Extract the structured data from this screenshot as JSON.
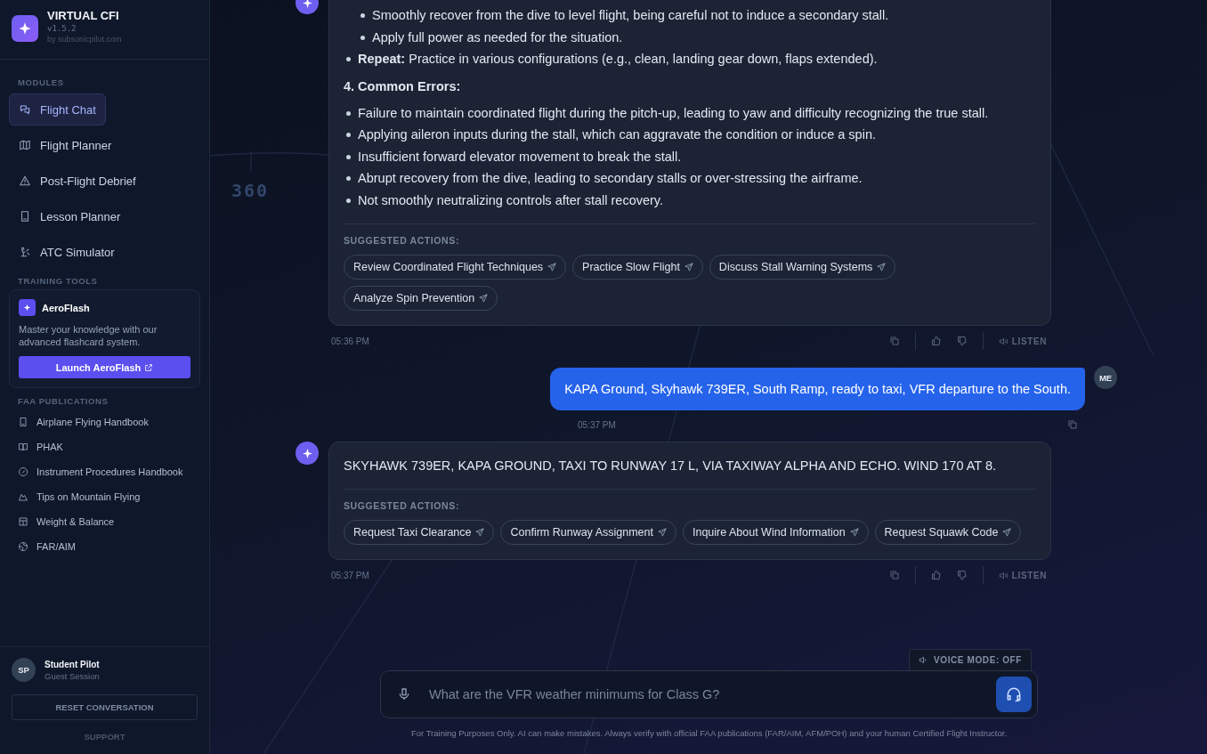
{
  "app": {
    "name": "VIRTUAL CFI",
    "version": "v1.5.2",
    "byline": "by subsonicpilot.com"
  },
  "sidebar": {
    "modules_label": "MODULES",
    "modules": [
      {
        "label": "Flight Chat",
        "selected": true
      },
      {
        "label": "Flight Planner",
        "selected": false
      },
      {
        "label": "Post-Flight Debrief",
        "selected": false
      },
      {
        "label": "Lesson Planner",
        "selected": false
      },
      {
        "label": "ATC Simulator",
        "selected": false
      }
    ],
    "training_label": "TRAINING TOOLS",
    "aeroflash": {
      "title": "AeroFlash",
      "description": "Master your knowledge with our advanced flashcard system.",
      "button": "Launch AeroFlash"
    },
    "publications_label": "FAA PUBLICATIONS",
    "publications": [
      "Airplane Flying Handbook",
      "PHAK",
      "Instrument Procedures Handbook",
      "Tips on Mountain Flying",
      "Weight & Balance",
      "FAR/AIM"
    ],
    "user": {
      "initials": "SP",
      "name": "Student Pilot",
      "session": "Guest Session"
    },
    "reset_button": "RESET CONVERSATION",
    "support_link": "SUPPORT"
  },
  "background_heading": "360",
  "chat": {
    "messages": [
      {
        "kind": "assistant",
        "content": [
          {
            "kind": "sub_bullet",
            "text": "Smoothly recover from the dive to level flight, being careful not to induce a secondary stall."
          },
          {
            "kind": "sub_bullet",
            "text": "Apply full power as needed for the situation."
          },
          {
            "kind": "bullet",
            "text": "**Repeat:** Practice in various configurations (e.g., clean, landing gear down, flaps extended)."
          },
          {
            "kind": "heading",
            "text": "4. Common Errors:"
          },
          {
            "kind": "bullet",
            "text": "Failure to maintain coordinated flight during the pitch-up, leading to yaw and difficulty recognizing the true stall."
          },
          {
            "kind": "bullet",
            "text": "Applying aileron inputs during the stall, which can aggravate the condition or induce a spin."
          },
          {
            "kind": "bullet",
            "text": "Insufficient forward elevator movement to break the stall."
          },
          {
            "kind": "bullet",
            "text": "Abrupt recovery from the dive, leading to secondary stalls or over-stressing the airframe."
          },
          {
            "kind": "bullet",
            "text": "Not smoothly neutralizing controls after stall recovery."
          }
        ],
        "suggested_label": "SUGGESTED ACTIONS:",
        "suggestions": [
          "Review Coordinated Flight Techniques",
          "Practice Slow Flight",
          "Discuss Stall Warning Systems",
          "Analyze Spin Prevention"
        ],
        "time": "05:36 PM",
        "listen": "LISTEN"
      },
      {
        "kind": "user",
        "avatar": "ME",
        "text": "KAPA Ground, Skyhawk 739ER, South Ramp, ready to taxi, VFR departure to the South.",
        "time": "05:37 PM"
      },
      {
        "kind": "assistant",
        "content": [
          {
            "kind": "paragraph",
            "text": "SKYHAWK 739ER, KAPA GROUND, TAXI TO RUNWAY 17 L, VIA TAXIWAY ALPHA AND ECHO. WIND 170 AT 8."
          }
        ],
        "suggested_label": "SUGGESTED ACTIONS:",
        "suggestions": [
          "Request Taxi Clearance",
          "Confirm Runway Assignment",
          "Inquire About Wind Information",
          "Request Squawk Code"
        ],
        "time": "05:37 PM",
        "listen": "LISTEN"
      }
    ]
  },
  "composer": {
    "voice_mode": "VOICE MODE: OFF",
    "placeholder": "What are the VFR weather minimums for Class G?",
    "disclaimer": "For Training Purposes Only. AI can make mistakes. Always verify with official FAA publications (FAR/AIM, AFM/POH) and your human Certified Flight Instructor."
  }
}
